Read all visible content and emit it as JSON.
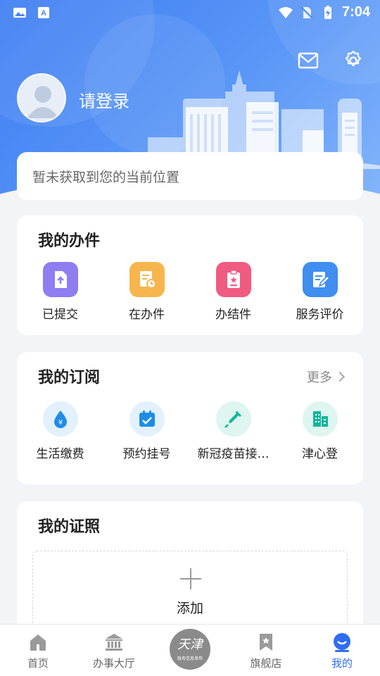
{
  "statusbar": {
    "time": "7:04"
  },
  "header": {
    "login_label": "请登录"
  },
  "icons": {
    "mail": "envelope-icon",
    "settings": "gear-icon",
    "avatar": "user-avatar-icon"
  },
  "location": {
    "text": "暂未获取到您的当前位置"
  },
  "my_cases": {
    "title": "我的办件",
    "items": [
      {
        "label": "已提交",
        "icon": "upload-file-icon",
        "color": "#8f7df2"
      },
      {
        "label": "在办件",
        "icon": "document-clock-icon",
        "color": "#f7b64d"
      },
      {
        "label": "办结件",
        "icon": "clipboard-star-icon",
        "color": "#f05b82"
      },
      {
        "label": "服务评价",
        "icon": "edit-note-icon",
        "color": "#3f8ef0"
      }
    ]
  },
  "subscriptions": {
    "title": "我的订阅",
    "more_label": "更多",
    "items": [
      {
        "label": "生活缴费",
        "icon": "water-drop-yuan-icon",
        "color": "#1e8de8"
      },
      {
        "label": "预约挂号",
        "icon": "calendar-check-icon",
        "color": "#1e8de8"
      },
      {
        "label": "新冠疫苗接…",
        "icon": "syringe-icon",
        "color": "#16b59c"
      },
      {
        "label": "津心登",
        "icon": "building-icon",
        "color": "#16b59c"
      }
    ]
  },
  "licenses": {
    "title": "我的证照",
    "add_label": "添加"
  },
  "tabbar": {
    "items": [
      {
        "label": "首页",
        "icon": "home-icon"
      },
      {
        "label": "办事大厅",
        "icon": "bank-hall-icon"
      },
      {
        "label": "",
        "icon": "tianjin-logo"
      },
      {
        "label": "旗舰店",
        "icon": "bookmark-star-icon"
      },
      {
        "label": "我的",
        "icon": "smile-user-icon"
      }
    ],
    "center_logo": {
      "line1": "天津",
      "line2": "政务信息发布"
    },
    "active_color": "#2f6df0"
  }
}
